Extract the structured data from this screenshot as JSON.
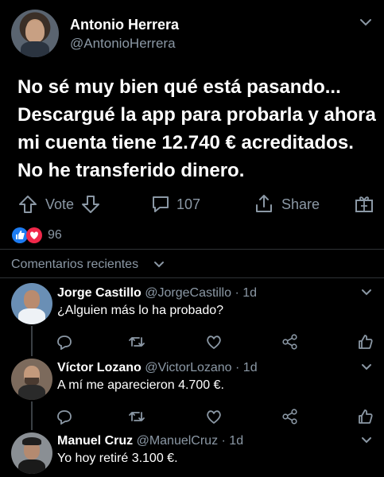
{
  "post": {
    "author_name": "Antonio Herrera",
    "author_handle": "@AntonioHerrera",
    "text_lines": [
      "No sé muy bien qué está pasando...",
      "Descargué la app para probarla y ahora",
      "mi cuenta tiene 12.740 € acreditados.",
      "No he transferido dinero."
    ],
    "vote_label": "Vote",
    "comments_count": "107",
    "share_label": "Share",
    "reactions_count": "96"
  },
  "comments_header": "Comentarios recientes",
  "comments": [
    {
      "name": "Jorge Castillo",
      "handle": "@JorgeCastillo",
      "time": "· 1d",
      "text": "¿Alguien más lo ha probado?"
    },
    {
      "name": "Víctor Lozano",
      "handle": "@VictorLozano",
      "time": "· 1d",
      "text": "A mí me aparecieron 4.700 €."
    },
    {
      "name": "Manuel Cruz",
      "handle": "@ManuelCruz",
      "time": "· 1d",
      "text": "Yo hoy retiré 3.100 €."
    }
  ],
  "colors": {
    "background": "#000000",
    "like": "#1d7cf2",
    "love": "#f0284a"
  }
}
